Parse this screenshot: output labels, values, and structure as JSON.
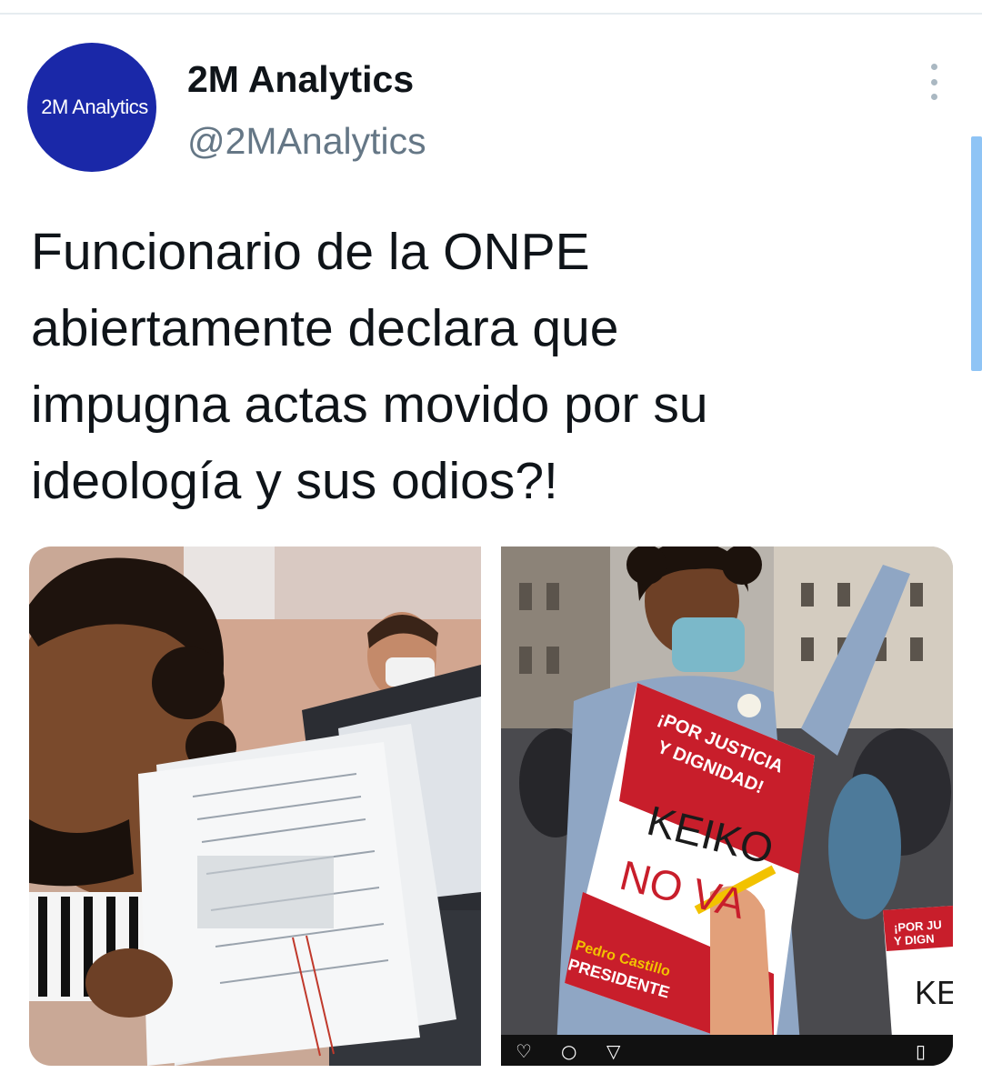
{
  "account": {
    "display_name": "2M Analytics",
    "handle": "@2MAnalytics",
    "avatar_text": "2M Analytics",
    "avatar_color": "#1a28a8"
  },
  "tweet": {
    "text": "Funcionario de la ONPE\nabiertamente declara que\nimpugna actas movido por su\nideología y sus odios?!"
  },
  "media": {
    "right_poster": {
      "line1": "¡POR JUSTICIA",
      "line2": "Y DIGNIDAD!",
      "slogan1": "KEIKO",
      "slogan2": "NO VA",
      "candidate": "Pedro Castillo",
      "candidate_role": "PRESIDENTE",
      "second_sign1": "¡POR JU",
      "second_sign2": "Y DIGN",
      "second_sign3": "KE"
    }
  },
  "icons": {
    "more": "more-vertical-icon",
    "like": "heart-icon",
    "comment": "comment-icon",
    "share": "send-icon",
    "save": "bookmark-icon"
  },
  "colors": {
    "text": "#0f1419",
    "secondary": "#657786",
    "scrollbar": "#8fc4f5",
    "poster_red": "#c81e2b"
  }
}
